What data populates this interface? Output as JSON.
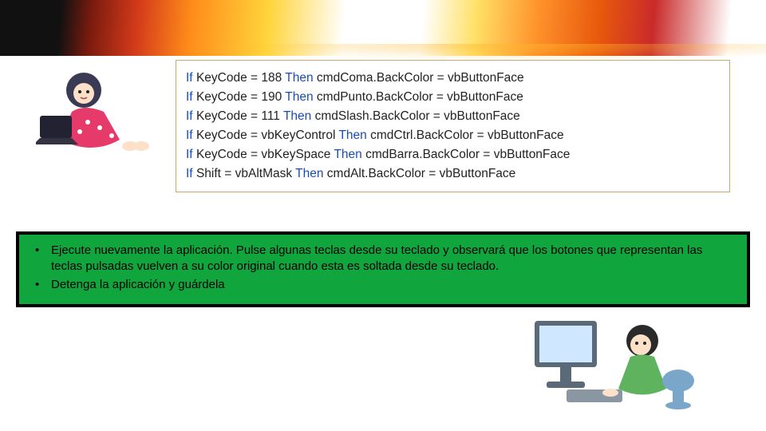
{
  "code_lines": [
    {
      "cond_lhs": "KeyCode",
      "op": "=",
      "cond_rhs": "188",
      "target": "cmdComa.BackColor",
      "value": "vbButtonFace"
    },
    {
      "cond_lhs": "KeyCode",
      "op": "=",
      "cond_rhs": "190",
      "target": "cmdPunto.BackColor",
      "value": "vbButtonFace"
    },
    {
      "cond_lhs": "KeyCode",
      "op": "=",
      "cond_rhs": "111",
      "target": "cmdSlash.BackColor",
      "value": "vbButtonFace"
    },
    {
      "cond_lhs": "KeyCode",
      "op": "=",
      "cond_rhs": "vbKeyControl",
      "target": "cmdCtrl.BackColor",
      "value": "vbButtonFace"
    },
    {
      "cond_lhs": "KeyCode",
      "op": "=",
      "cond_rhs": "vbKeySpace",
      "target": "cmdBarra.BackColor",
      "value": "vbButtonFace"
    },
    {
      "cond_lhs": "Shift",
      "op": "=",
      "cond_rhs": "vbAltMask",
      "target": "cmdAlt.BackColor",
      "value": "vbButtonFace"
    }
  ],
  "instructions": {
    "items": [
      "Ejecute nuevamente la aplicación. Pulse algunas teclas desde su teclado y observará que los botones que representan las teclas pulsadas vuelven a su color original cuando esta es soltada desde su teclado.",
      "Detenga la aplicación y guárdela"
    ]
  },
  "illustrations": {
    "left_alt": "girl-with-laptop",
    "right_alt": "boy-at-computer"
  },
  "colors": {
    "instruction_bg": "#11a53d",
    "code_border": "#c9a96e",
    "keyword": "#1a4db3"
  }
}
